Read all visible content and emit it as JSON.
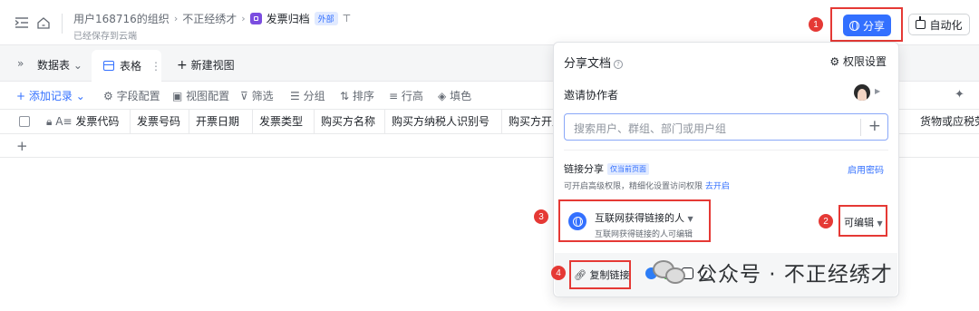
{
  "header": {
    "org": "用户168716的组织",
    "folder": "不正经绣才",
    "doc_title": "发票归档",
    "external_tag": "外部",
    "saved_status": "已经保存到云端",
    "share_label": "分享",
    "automation_label": "自动化"
  },
  "badges": [
    "1",
    "2",
    "3",
    "4"
  ],
  "tabs": {
    "collapse_glyph": "»",
    "dataset_label": "数据表",
    "active_tab": "表格",
    "new_view": "新建视图"
  },
  "toolbar": {
    "add_record": "添加记录",
    "field_config": "字段配置",
    "view_config": "视图配置",
    "filter": "筛选",
    "group": "分组",
    "sort": "排序",
    "row_height": "行高",
    "fill_color": "填色"
  },
  "columns": [
    "发票代码",
    "发票号码",
    "开票日期",
    "发票类型",
    "购买方名称",
    "购买方纳税人识别号",
    "购买方开户",
    "货物或应税劳务"
  ],
  "share_panel": {
    "title": "分享文档",
    "permission_settings": "权限设置",
    "invite_label": "邀请协作者",
    "search_placeholder": "搜索用户、群组、部门或用户组",
    "link_share_label": "链接分享",
    "current_page_tag": "仅当前页面",
    "enable_password": "启用密码",
    "link_desc": "可开启高级权限，精细化设置访问权限",
    "open_link": "去开启",
    "scope_label": "互联网获得链接的人",
    "scope_desc": "互联网获得链接的人可编辑",
    "permission_value": "可编辑",
    "copy_link": "复制链接"
  },
  "watermark": "公众号 · 不正经绣才",
  "colors": {
    "accent": "#3370ff",
    "highlight": "#e53935"
  }
}
